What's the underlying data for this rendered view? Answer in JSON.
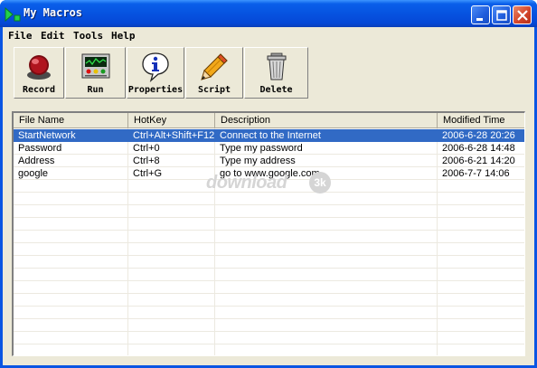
{
  "window": {
    "title": "My Macros"
  },
  "menu": {
    "items": [
      "File",
      "Edit",
      "Tools",
      "Help"
    ]
  },
  "toolbar": {
    "buttons": [
      {
        "label": "Record",
        "icon": "record-icon"
      },
      {
        "label": "Run",
        "icon": "run-icon"
      },
      {
        "label": "Properties",
        "icon": "info-icon"
      },
      {
        "label": "Script",
        "icon": "pencil-icon"
      },
      {
        "label": "Delete",
        "icon": "trash-icon"
      }
    ]
  },
  "list": {
    "columns": [
      "File Name",
      "HotKey",
      "Description",
      "Modified Time"
    ],
    "rows": [
      {
        "file": "StartNetwork",
        "hotkey": "Ctrl+Alt+Shift+F12",
        "description": "Connect to the Internet",
        "modified": "2006-6-28 20:26",
        "selected": true
      },
      {
        "file": "Password",
        "hotkey": "Ctrl+0",
        "description": "Type my password",
        "modified": "2006-6-28 14:48",
        "selected": false
      },
      {
        "file": "Address",
        "hotkey": "Ctrl+8",
        "description": "Type my address",
        "modified": "2006-6-21 14:20",
        "selected": false
      },
      {
        "file": "google",
        "hotkey": "Ctrl+G",
        "description": "go to www.google.com",
        "modified": "2006-7-7 14:06",
        "selected": false
      }
    ]
  },
  "watermark": {
    "text": "download",
    "badge": "3k"
  },
  "colors": {
    "titlebar": "#0a5fea",
    "selection": "#316ac5",
    "face": "#ece9d8"
  }
}
